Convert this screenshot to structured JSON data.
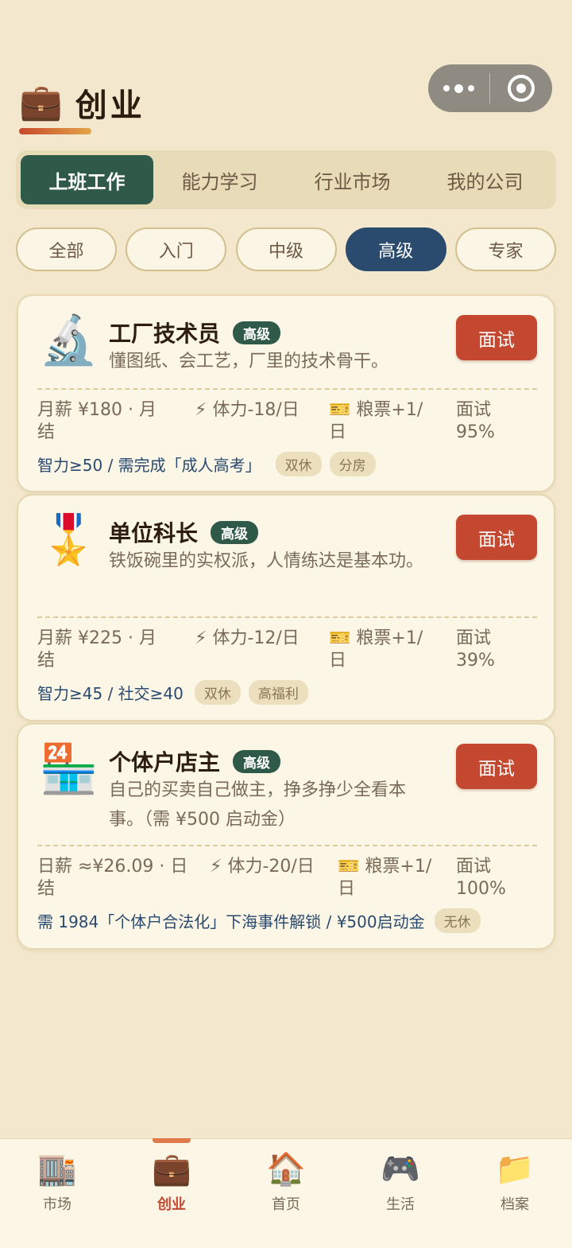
{
  "header": {
    "icon": "💼",
    "icon_name": "briefcase-icon",
    "title": "创业"
  },
  "capsule": {
    "more": "more-icon",
    "close": "target-icon"
  },
  "tabs": [
    {
      "label": "上班工作",
      "active": true
    },
    {
      "label": "能力学习",
      "active": false
    },
    {
      "label": "行业市场",
      "active": false
    },
    {
      "label": "我的公司",
      "active": false
    }
  ],
  "filters": [
    {
      "label": "全部",
      "active": false
    },
    {
      "label": "入门",
      "active": false
    },
    {
      "label": "中级",
      "active": false
    },
    {
      "label": "高级",
      "active": true
    },
    {
      "label": "专家",
      "active": false
    }
  ],
  "jobs": [
    {
      "icon": "🔬",
      "icon_name": "microscope-icon",
      "name": "工厂技术员",
      "level": "高级",
      "desc": "懂图纸、会工艺，厂里的技术骨干。",
      "apply": "面试",
      "salary": "月薪 ¥180 · 月结",
      "stamina": "⚡ 体力-18/日",
      "ticket": "🎫 粮票+1/日",
      "chance": "面试 95%",
      "requirement": "智力≥50 / 需完成「成人高考」",
      "tags": [
        "双休",
        "分房"
      ]
    },
    {
      "icon": "🎖️",
      "icon_name": "medal-icon",
      "name": "单位科长",
      "level": "高级",
      "desc": "铁饭碗里的实权派，人情练达是基本功。",
      "apply": "面试",
      "salary": "月薪 ¥225 · 月结",
      "stamina": "⚡ 体力-12/日",
      "ticket": "🎫 粮票+1/日",
      "chance": "面试 39%",
      "requirement": "智力≥45 / 社交≥40",
      "tags": [
        "双休",
        "高福利"
      ]
    },
    {
      "icon": "🏪",
      "icon_name": "convenience-store-icon",
      "name": "个体户店主",
      "level": "高级",
      "desc": "自己的买卖自己做主，挣多挣少全看本事。（需 ¥500 启动金）",
      "apply": "面试",
      "salary": "日薪 ≈¥26.09 · 日结",
      "stamina": "⚡ 体力-20/日",
      "ticket": "🎫 粮票+1/日",
      "chance": "面试 100%",
      "requirement": "需 1984「个体户合法化」下海事件解锁 / ¥500启动金",
      "tags": [
        "无休"
      ]
    }
  ],
  "nav": [
    {
      "icon": "🏬",
      "icon_name": "department-store-icon",
      "label": "市场",
      "active": false
    },
    {
      "icon": "💼",
      "icon_name": "briefcase-icon",
      "label": "创业",
      "active": true
    },
    {
      "icon": "🏠",
      "icon_name": "house-icon",
      "label": "首页",
      "active": false
    },
    {
      "icon": "🎮",
      "icon_name": "gamepad-icon",
      "label": "生活",
      "active": false
    },
    {
      "icon": "📁",
      "icon_name": "folder-icon",
      "label": "档案",
      "active": false
    }
  ]
}
